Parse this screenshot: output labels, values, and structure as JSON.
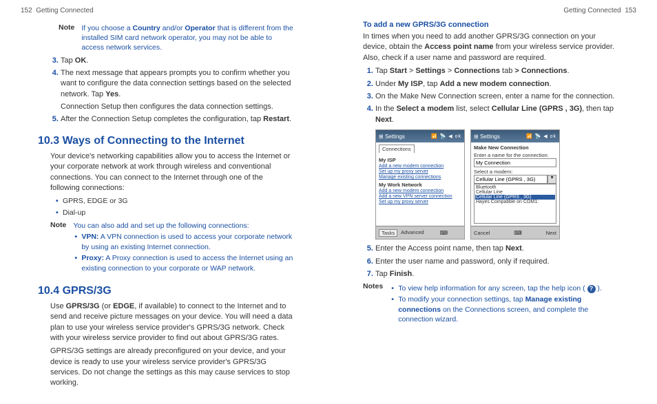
{
  "header": {
    "left_page_num": "152",
    "right_page_num": "153",
    "section_title": "Getting Connected"
  },
  "left": {
    "note1": {
      "label": "Note",
      "text_parts": [
        "If you choose a ",
        "Country",
        " and/or ",
        "Operator",
        " that is different from the installed SIM card network operator, you may not be able to access network services."
      ]
    },
    "steps1": {
      "s3": [
        "Tap ",
        "OK",
        "."
      ],
      "s4_a": [
        "The next message that appears prompts you to confirm whether you want to configure the data connection settings based on the selected network. Tap ",
        "Yes",
        "."
      ],
      "s4_b": "Connection Setup then configures the data connection settings.",
      "s5": [
        "After the Connection Setup completes the configuration, tap ",
        "Restart",
        "."
      ]
    },
    "h2_103": "10.3  Ways of Connecting to the Internet",
    "p103": "Your device's networking capabilities allow you to access the Internet or your corporate network at work through wireless and conventional connections. You can connect to the Internet through one of the following connections:",
    "bullets103": [
      "GPRS, EDGE or 3G",
      "Dial-up"
    ],
    "note2": {
      "label": "Note",
      "intro": "You can also add and set up the following connections:",
      "items": [
        {
          "b": "VPN:",
          "t": " A VPN connection is used to access your corporate network by using an existing Internet connection."
        },
        {
          "b": "Proxy:",
          "t": " A Proxy connection is used to access the Internet using an existing connection to your corporate or WAP network."
        }
      ]
    },
    "h2_104": "10.4  GPRS/3G",
    "p104a": [
      "Use ",
      "GPRS/3G",
      " (or ",
      "EDGE",
      ", if available) to connect to the Internet and to send and receive picture messages on your device. You will need a data plan to use your wireless service provider's GPRS/3G network. Check with your wireless service provider to find out about GPRS/3G rates."
    ],
    "p104b": "GPRS/3G settings are already preconfigured on your device, and your device is ready to use your wireless service provider's GPRS/3G services. Do not change the settings as this may cause services to stop working."
  },
  "right": {
    "h3": "To add a new GPRS/3G connection",
    "intro": [
      "In times when you need to add another GPRS/3G connection on your device, obtain the ",
      "Access point name",
      " from your wireless service provider. Also, check if a user name and password are required."
    ],
    "steps": {
      "s1": [
        "Tap ",
        "Start",
        " > ",
        "Settings",
        " > ",
        "Connections",
        " tab ",
        "> ",
        "Connections",
        "."
      ],
      "s2": [
        "Under ",
        "My ISP",
        ", tap ",
        "Add a new modem connection",
        "."
      ],
      "s3": "On the Make New Connection screen, enter a name for the connection.",
      "s4": [
        "In the ",
        "Select a modem",
        " list, select ",
        "Cellular Line (GPRS , 3G)",
        ", then tap ",
        "Next",
        "."
      ]
    },
    "screen1": {
      "title": "Settings",
      "tab": "Connections",
      "grp1": "My ISP",
      "l1": "Add a new modem connection",
      "l2": "Set up my proxy server",
      "l3": "Manage existing connections",
      "grp2": "My Work Network",
      "l4": "Add a new modem connection",
      "l5": "Add a new VPN server connection",
      "l6": "Set up my proxy server",
      "bottom_tabs": [
        "Tasks",
        "Advanced"
      ]
    },
    "screen2": {
      "title": "Settings",
      "subtitle": "Make New Connection",
      "label1": "Enter a name for the connection:",
      "value1": "My Connection",
      "label2": "Select a modem:",
      "sel": "Cellular Line (GPRS , 3G)",
      "opts": [
        "Bluetooth",
        "Cellular Line",
        "Cellular Line (GPRS , 3G)",
        "Hayes Compatible on COM1:"
      ],
      "bottom_left": "Cancel",
      "bottom_right": "Next"
    },
    "steps2": {
      "s5": [
        "Enter the Access point name, then tap ",
        "Next",
        "."
      ],
      "s6": "Enter the user name and password, only if required.",
      "s7": [
        "Tap ",
        "Finish",
        "."
      ]
    },
    "notes": {
      "label": "Notes",
      "items": [
        {
          "pre": "To view help information for any screen, tap the help icon ( ",
          "post": " )."
        },
        {
          "text": [
            "To modify your connection settings, tap ",
            "Manage existing connections",
            " on the Connections screen, and complete the connection wizard."
          ]
        }
      ]
    }
  }
}
